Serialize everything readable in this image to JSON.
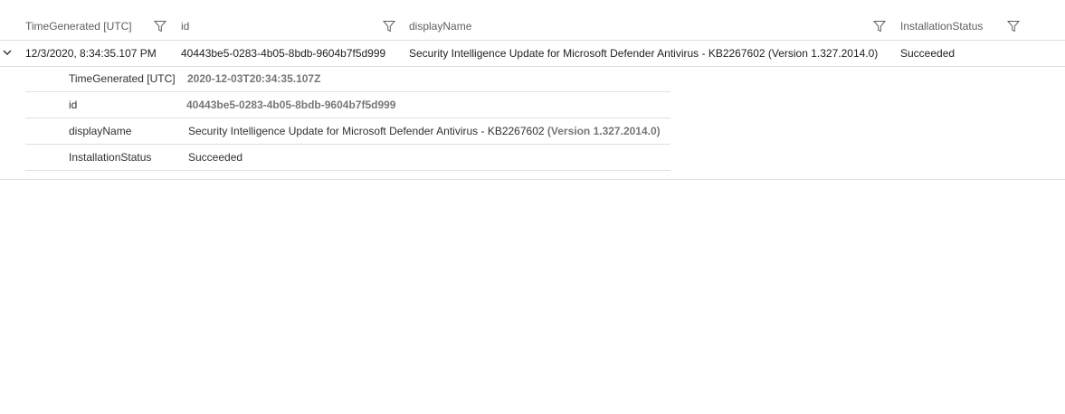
{
  "columns": [
    {
      "label": "TimeGenerated [UTC]"
    },
    {
      "label": "id"
    },
    {
      "label": "displayName"
    },
    {
      "label": "InstallationStatus"
    }
  ],
  "row": {
    "time_generated": "12/3/2020, 8:34:35.107 PM",
    "id": "40443be5-0283-4b05-8bdb-9604b7f5d999",
    "display_name": "Security Intelligence Update for Microsoft Defender Antivirus - KB2267602 (Version 1.327.2014.0)",
    "installation_status": "Succeeded"
  },
  "details": {
    "time_generated": {
      "key": "TimeGenerated [UTC]",
      "value": "2020-12-03T20:34:35.107Z"
    },
    "id": {
      "key": "id",
      "value": "40443be5-0283-4b05-8bdb-9604b7f5d999"
    },
    "display_name": {
      "key": "displayName",
      "value": "Security Intelligence Update for Microsoft Defender Antivirus - KB2267602",
      "value_suffix": "(Version 1.327.2014.0)"
    },
    "installation_status": {
      "key": "InstallationStatus",
      "value": "Succeeded"
    }
  },
  "icons": {
    "filter": "filter-icon",
    "expand": "chevron-down-icon"
  },
  "colors": {
    "header_text": "#605e5c",
    "cell_text": "#201f1e",
    "muted_value": "#797775",
    "divider": "#e1dfdd"
  }
}
